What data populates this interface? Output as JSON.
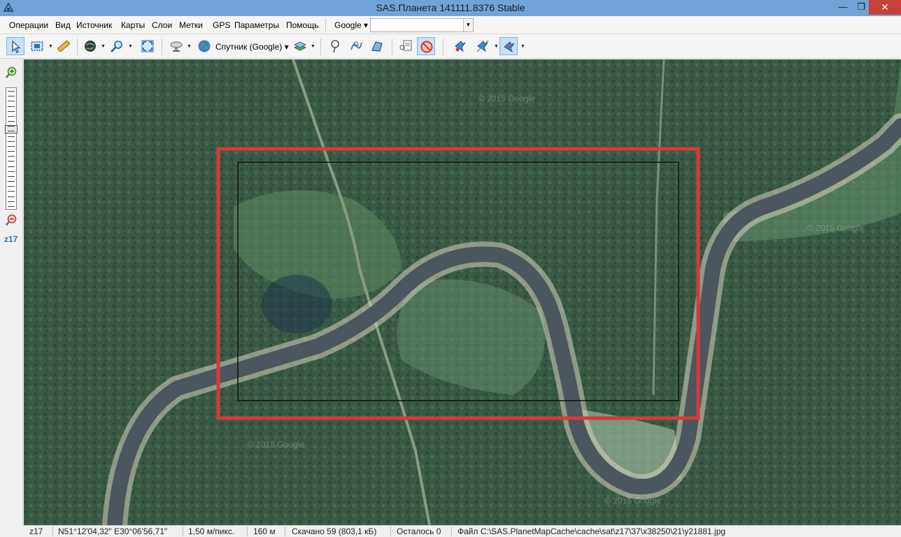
{
  "window": {
    "title": "SAS.Планета 141111.8376 Stable",
    "minimize_glyph": "—",
    "maximize_glyph": "❐",
    "close_glyph": "✕"
  },
  "menu": {
    "items": [
      "Операции",
      "Вид",
      "Источник",
      "Карты",
      "Слои",
      "Метки",
      "GPS",
      "Параметры",
      "Помощь"
    ],
    "search_provider": "Google ▾",
    "search_value": ""
  },
  "toolbar": {
    "map_source_label": "Спутник (Google) ▾",
    "icons": [
      "select-arrow-icon",
      "select-rect-icon",
      "ruler-icon",
      "globe-icon",
      "magnifier-icon",
      "fullscreen-icon",
      "satellite-dish-icon",
      "earth-icon",
      "layers-icon",
      "placemark-icon",
      "path-icon",
      "polygon-icon",
      "marks-list-icon",
      "hide-marks-icon",
      "gps-connect-icon",
      "gps-track-icon",
      "gps-center-icon"
    ]
  },
  "zoom": {
    "level": "z17",
    "slider_fraction": 0.33
  },
  "map": {
    "watermark": "© 2015 Google",
    "colors": {
      "forest": "#3a5a45",
      "river": "#4a5660",
      "sand": "#d9d2bd",
      "meadow": "#6f9a72",
      "red_selection": "#d63a3a",
      "black_selection": "#111111"
    }
  },
  "status": {
    "zoom": "z17",
    "coords": "N51°12'04,32\" E30°06'56,71\"",
    "scale": "1,50 м/пикс.",
    "distance": "160 м",
    "downloaded": "Скачано 59 (803,1 кБ)",
    "remaining": "Осталось 0",
    "file": "Файл C:\\SAS.PlanetMapCache\\cache\\sat\\z17\\37\\x38250\\21\\y21881.jpg"
  }
}
